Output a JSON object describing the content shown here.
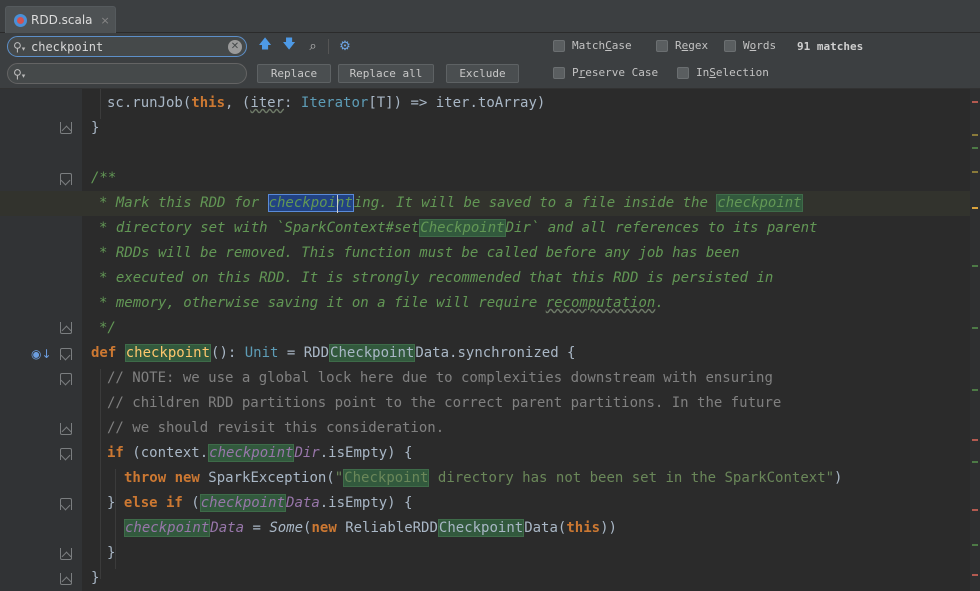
{
  "tab": {
    "label": "RDD.scala",
    "close": "×"
  },
  "search": {
    "query": "checkpoint",
    "replace_value": "",
    "match_count": "91 matches"
  },
  "buttons": {
    "replace": "Replace",
    "replace_all": "Replace all",
    "exclude": "Exclude"
  },
  "options": {
    "match_case": {
      "pre": "Match ",
      "u": "C",
      "post": "ase",
      "checked": false
    },
    "regex": {
      "pre": "R",
      "u": "e",
      "post": "gex",
      "checked": false
    },
    "words": {
      "pre": "W",
      "u": "o",
      "post": "rds",
      "checked": false
    },
    "preserve_case": {
      "pre": "P",
      "u": "r",
      "post": "eserve Case",
      "checked": false
    },
    "in_selection": {
      "pre": "In ",
      "u": "S",
      "post": "election",
      "checked": false
    }
  },
  "icons": {
    "search": "search-icon",
    "clear": "clear-icon",
    "prev": "arrow-up-icon",
    "next": "arrow-down-icon",
    "find_all": "find-all-icon",
    "settings": "gear-icon",
    "bookmark": "override-marker-icon"
  },
  "colors": {
    "background": "#2b2b2b",
    "keyword": "#cc7832",
    "doc_comment": "#629755",
    "line_comment": "#808080",
    "string": "#6a8759",
    "search_highlight": "#32593d",
    "selection": "#214283"
  },
  "code": {
    "l1": {
      "a": "sc.runJob(",
      "b": "this",
      "c": ", (",
      "d": "iter",
      "e": ": ",
      "f": "Iterator",
      "g": "[T]) => iter.toArray)"
    },
    "l2": "}",
    "l4": "/**",
    "l5": {
      "a": "* Mark this RDD for ",
      "b": "checkpoint",
      "c": "ing. It will be saved to a file inside the ",
      "d": "checkpoint"
    },
    "l6": {
      "a": "* directory set with `SparkContext#set",
      "b": "Checkpoint",
      "c": "Dir` and all references to its parent"
    },
    "l7": "* RDDs will be removed. This function must be called before any job has been",
    "l8": "* executed on this RDD. It is strongly recommended that this RDD is persisted in",
    "l9": {
      "a": "* memory, otherwise saving it on a file will require ",
      "b": "recomputation",
      "c": "."
    },
    "l10": "*/",
    "l11": {
      "a": "def ",
      "b": "checkpoint",
      "c": "(): ",
      "d": "Unit",
      "e": " = RDD",
      "f": "Checkpoint",
      "g": "Data.synchronized {"
    },
    "l12": "// NOTE: we use a global lock here due to complexities downstream with ensuring",
    "l13": "// children RDD partitions point to the correct parent partitions. In the future",
    "l14": "// we should revisit this consideration.",
    "l15": {
      "a": "if",
      "b": " (context.",
      "c": "checkpoint",
      "d": "Dir",
      "e": ".isEmpty) {"
    },
    "l16": {
      "a": "throw new ",
      "b": "SparkException(",
      "c": "\"",
      "d": "Checkpoint",
      "e": " directory has not been set in the SparkContext\"",
      "f": ")"
    },
    "l17": {
      "a": "} ",
      "b": "else if",
      "c": " (",
      "d": "checkpoint",
      "e": "Data",
      "f": ".isEmpty) {"
    },
    "l18": {
      "a": "checkpoint",
      "b": "Data",
      "c": " = ",
      "d": "Some",
      "e": "(",
      "f": "new ",
      "g": "ReliableRDD",
      "h": "Checkpoint",
      "i": "Data(",
      "j": "this",
      "k": "))"
    },
    "l19": "}",
    "l20": "}"
  }
}
